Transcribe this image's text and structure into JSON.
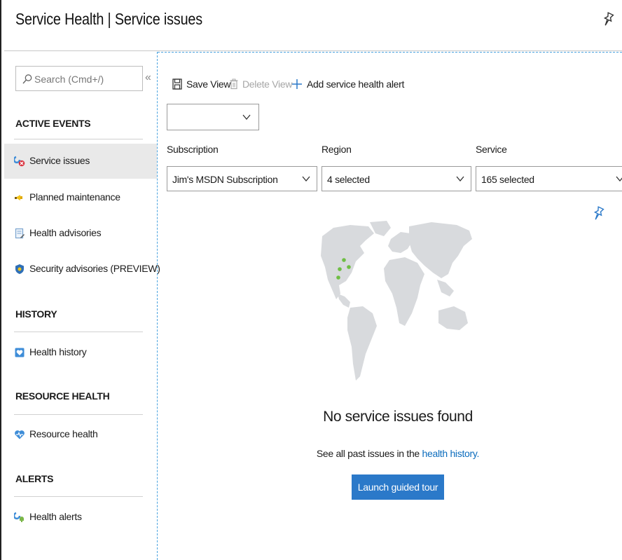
{
  "window": {
    "title": "Service Health | Service issues",
    "pin_icon": "pin-icon",
    "close_icon": "close-icon"
  },
  "sidebar": {
    "search_placeholder": "Search (Cmd+/)",
    "collapse_label": "«",
    "sections": [
      {
        "heading": "ACTIVE EVENTS",
        "items": [
          {
            "label": "Service issues",
            "icon": "service-issues-icon",
            "selected": true
          },
          {
            "label": "Planned maintenance",
            "icon": "megaphone-icon"
          },
          {
            "label": "Health advisories",
            "icon": "advisory-document-icon"
          },
          {
            "label": "Security advisories (PREVIEW)",
            "icon": "shield-icon"
          }
        ]
      },
      {
        "heading": "HISTORY",
        "items": [
          {
            "label": "Health history",
            "icon": "health-history-icon"
          }
        ]
      },
      {
        "heading": "RESOURCE HEALTH",
        "items": [
          {
            "label": "Resource health",
            "icon": "heart-pulse-icon"
          }
        ]
      },
      {
        "heading": "ALERTS",
        "items": [
          {
            "label": "Health alerts",
            "icon": "health-alerts-icon"
          }
        ]
      }
    ]
  },
  "toolbar": {
    "save_view": "Save View",
    "delete_view": "Delete View",
    "add_alert": "Add service health alert"
  },
  "view_select": {
    "value": ""
  },
  "filters": {
    "subscription": {
      "label": "Subscription",
      "value": "Jim's MSDN Subscription"
    },
    "region": {
      "label": "Region",
      "value": "4 selected"
    },
    "service": {
      "label": "Service",
      "value": "165 selected"
    }
  },
  "empty_state": {
    "title": "No service issues found",
    "subtitle_prefix": "See all past issues in the ",
    "subtitle_link": "health history.",
    "button": "Launch guided tour"
  },
  "colors": {
    "accent": "#2b79c9",
    "link": "#0b6cbd",
    "map_land": "#d8dadd",
    "map_point": "#6fbe44",
    "selected_bg": "#e9e9e9"
  }
}
